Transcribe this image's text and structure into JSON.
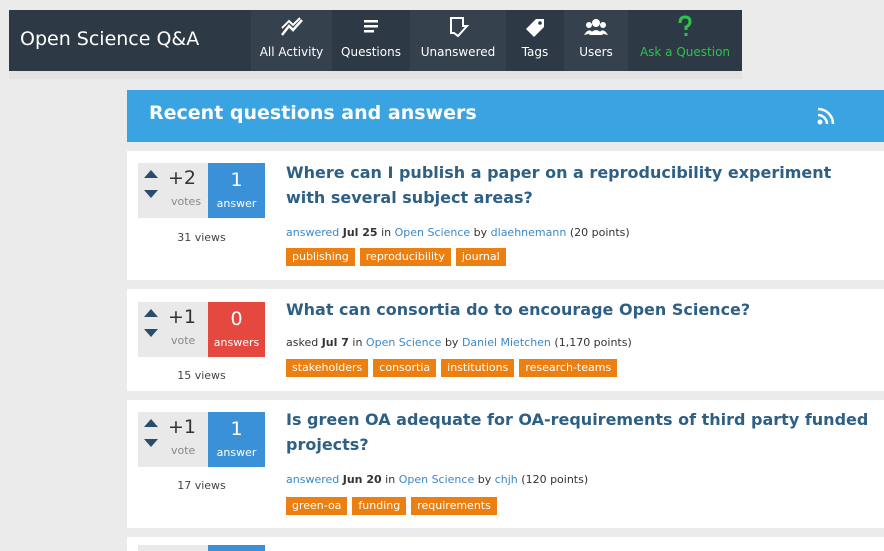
{
  "site": {
    "title": "Open Science Q&A"
  },
  "nav": {
    "items": [
      {
        "label": "All Activity",
        "icon": "activity-icon"
      },
      {
        "label": "Questions",
        "icon": "questions-icon"
      },
      {
        "label": "Unanswered",
        "icon": "unanswered-icon"
      },
      {
        "label": "Tags",
        "icon": "tag-icon"
      },
      {
        "label": "Users",
        "icon": "users-icon"
      },
      {
        "label": "Ask a Question",
        "icon": "question-mark-icon"
      }
    ]
  },
  "header": {
    "title": "Recent questions and answers",
    "feed_icon": "rss-icon"
  },
  "questions": [
    {
      "votes": "+2",
      "vote_label": "votes",
      "answers": "1",
      "answer_label": "answer",
      "views": "31 views",
      "title": "Where can I publish a paper on a reproducibility experiment with several subject areas?",
      "action": "answered",
      "date": "Jul 25",
      "in_word": "in",
      "category": "Open Science",
      "by_word": "by",
      "user": "dlaehnemann",
      "points": "(20 points)",
      "tags": [
        "publishing",
        "reproducibility",
        "journal"
      ]
    },
    {
      "votes": "+1",
      "vote_label": "vote",
      "answers": "0",
      "answer_label": "answers",
      "views": "15 views",
      "title": "What can consortia do to encourage Open Science?",
      "action": "asked",
      "date": "Jul 7",
      "in_word": "in",
      "category": "Open Science",
      "by_word": "by",
      "user": "Daniel Mietchen",
      "points": "(1,170 points)",
      "tags": [
        "stakeholders",
        "consortia",
        "institutions",
        "research-teams"
      ]
    },
    {
      "votes": "+1",
      "vote_label": "vote",
      "answers": "1",
      "answer_label": "answer",
      "views": "17 views",
      "title": "Is green OA adequate for OA-requirements of third party funded projects?",
      "action": "answered",
      "date": "Jun 20",
      "in_word": "in",
      "category": "Open Science",
      "by_word": "by",
      "user": "chjh",
      "points": "(120 points)",
      "tags": [
        "green-oa",
        "funding",
        "requirements"
      ]
    }
  ],
  "colors": {
    "topbar": "#2d3944",
    "header": "#3aa3e2",
    "answered": "#3a91d8",
    "unanswered": "#e5483f",
    "tag": "#eb7f12",
    "ask": "#2dc449"
  }
}
